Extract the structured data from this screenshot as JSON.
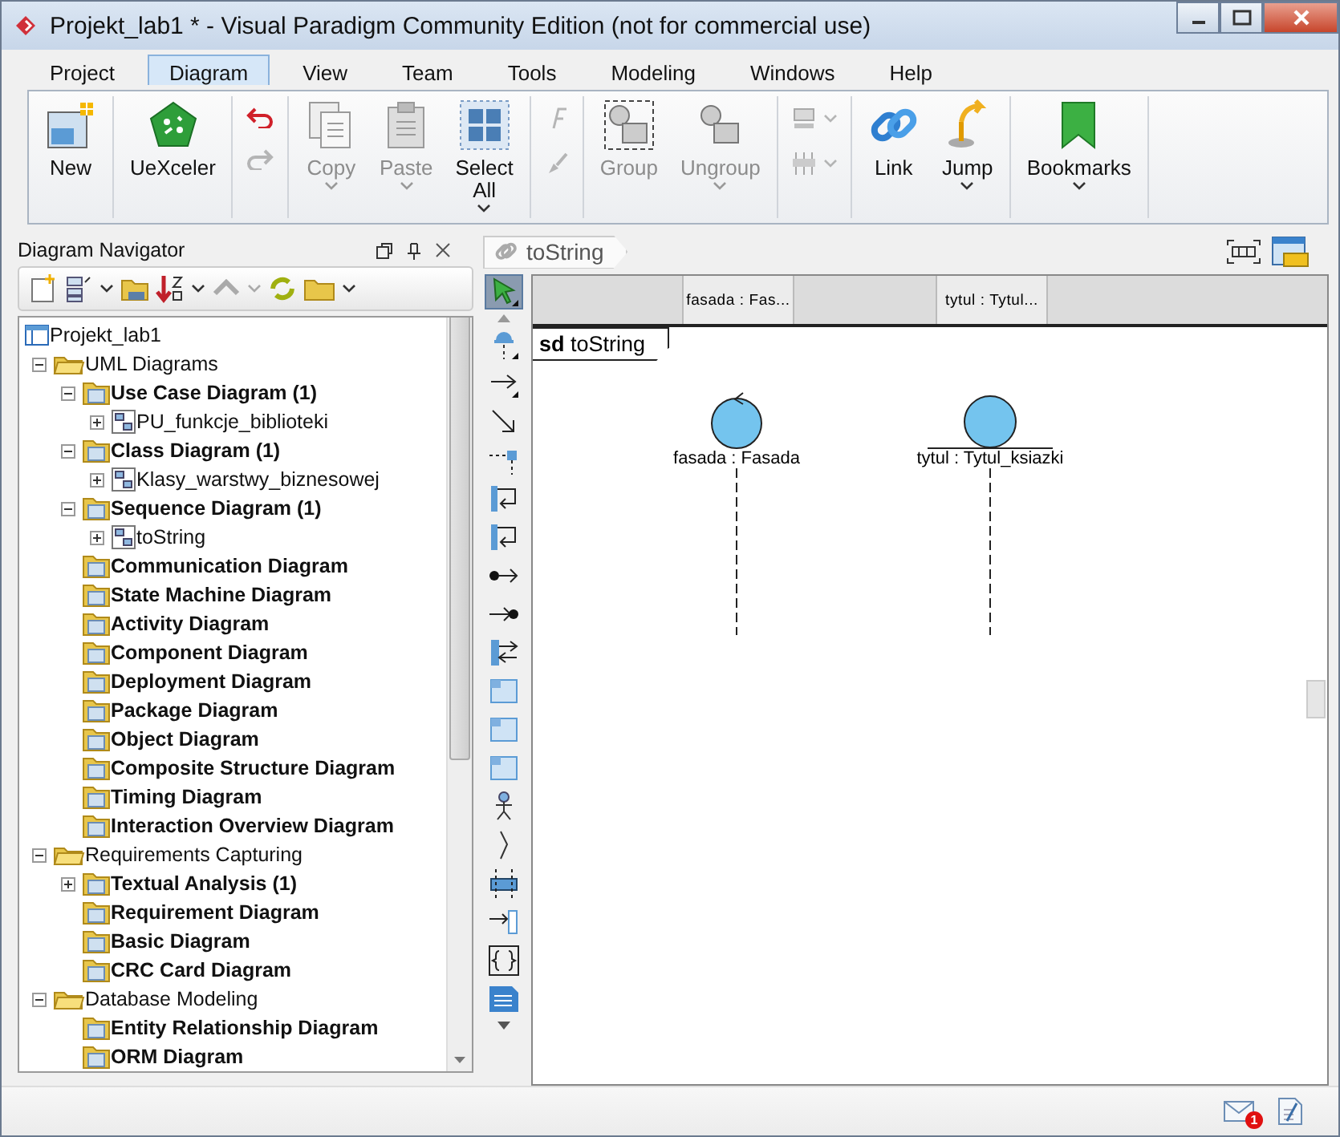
{
  "window": {
    "title": "Projekt_lab1 * - Visual Paradigm Community Edition (not for commercial use)"
  },
  "menu": [
    {
      "label": "Project",
      "selected": false
    },
    {
      "label": "Diagram",
      "selected": true
    },
    {
      "label": "View",
      "selected": false
    },
    {
      "label": "Team",
      "selected": false
    },
    {
      "label": "Tools",
      "selected": false
    },
    {
      "label": "Modeling",
      "selected": false
    },
    {
      "label": "Windows",
      "selected": false
    },
    {
      "label": "Help",
      "selected": false
    }
  ],
  "ribbon": {
    "groups": [
      {
        "kind": "large",
        "items": [
          {
            "kind": "new",
            "label": "New",
            "disabled": false,
            "dropdown": false
          }
        ]
      },
      {
        "kind": "large",
        "items": [
          {
            "kind": "pentagon",
            "label": "UeXceler",
            "disabled": false,
            "dropdown": false
          }
        ]
      },
      {
        "kind": "stack",
        "items": [
          {
            "kind": "undo",
            "disabled": false,
            "dropdown": false
          },
          {
            "kind": "redo",
            "disabled": true,
            "dropdown": false
          }
        ]
      },
      {
        "kind": "large",
        "items": [
          {
            "kind": "copy",
            "label": "Copy",
            "disabled": true,
            "dropdown": true
          },
          {
            "kind": "paste",
            "label": "Paste",
            "disabled": true,
            "dropdown": true
          },
          {
            "kind": "grid",
            "label": "Select All",
            "disabled": false,
            "dropdown": true
          }
        ]
      },
      {
        "kind": "stack",
        "items": [
          {
            "kind": "font",
            "disabled": true,
            "dropdown": false
          },
          {
            "kind": "brush",
            "disabled": true,
            "dropdown": false
          }
        ]
      },
      {
        "kind": "large",
        "items": [
          {
            "kind": "group",
            "label": "Group",
            "disabled": true,
            "dropdown": false
          },
          {
            "kind": "ungroup",
            "label": "Ungroup",
            "disabled": true,
            "dropdown": true
          }
        ]
      },
      {
        "kind": "stack",
        "items": [
          {
            "kind": "align",
            "disabled": true,
            "dropdown": true
          },
          {
            "kind": "distribute",
            "disabled": true,
            "dropdown": true
          }
        ]
      },
      {
        "kind": "large",
        "items": [
          {
            "kind": "link",
            "label": "Link",
            "disabled": false,
            "dropdown": false
          },
          {
            "kind": "jump",
            "label": "Jump",
            "disabled": false,
            "dropdown": true
          }
        ]
      },
      {
        "kind": "large",
        "items": [
          {
            "kind": "bookmark",
            "label": "Bookmarks",
            "disabled": false,
            "dropdown": true
          }
        ]
      }
    ]
  },
  "navigator": {
    "title": "Diagram Navigator",
    "tree": [
      {
        "kind": "project",
        "label": "Projekt_lab1",
        "children": [
          {
            "kind": "folder",
            "label": "UML Diagrams",
            "expanded": true,
            "children": [
              {
                "kind": "type",
                "label": "Use Case Diagram (1)",
                "expanded": true,
                "children": [
                  {
                    "kind": "diagram",
                    "label": "PU_funkcje_biblioteki",
                    "expanded": false
                  }
                ]
              },
              {
                "kind": "type",
                "label": "Class Diagram (1)",
                "expanded": true,
                "children": [
                  {
                    "kind": "diagram",
                    "label": "Klasy_warstwy_biznesowej",
                    "expanded": false
                  }
                ]
              },
              {
                "kind": "type",
                "label": "Sequence Diagram (1)",
                "expanded": true,
                "children": [
                  {
                    "kind": "diagram",
                    "label": "toString",
                    "expanded": false
                  }
                ]
              },
              {
                "kind": "type",
                "label": "Communication Diagram"
              },
              {
                "kind": "type",
                "label": "State Machine Diagram"
              },
              {
                "kind": "type",
                "label": "Activity Diagram"
              },
              {
                "kind": "type",
                "label": "Component Diagram"
              },
              {
                "kind": "type",
                "label": "Deployment Diagram"
              },
              {
                "kind": "type",
                "label": "Package Diagram"
              },
              {
                "kind": "type",
                "label": "Object Diagram"
              },
              {
                "kind": "type",
                "label": "Composite Structure Diagram"
              },
              {
                "kind": "type",
                "label": "Timing Diagram"
              },
              {
                "kind": "type",
                "label": "Interaction Overview Diagram"
              }
            ]
          },
          {
            "kind": "folder",
            "label": "Requirements Capturing",
            "expanded": true,
            "children": [
              {
                "kind": "type",
                "label": "Textual Analysis (1)",
                "expanded": false
              },
              {
                "kind": "type",
                "label": "Requirement Diagram"
              },
              {
                "kind": "type",
                "label": "Basic Diagram"
              },
              {
                "kind": "type",
                "label": "CRC Card Diagram"
              }
            ]
          },
          {
            "kind": "folder",
            "label": "Database Modeling",
            "expanded": true,
            "children": [
              {
                "kind": "type",
                "label": "Entity Relationship Diagram"
              },
              {
                "kind": "type",
                "label": "ORM Diagram"
              }
            ]
          }
        ]
      }
    ]
  },
  "editor": {
    "breadcrumb": "toString",
    "palette": [
      {
        "kind": "pointer",
        "selected": true
      },
      {
        "kind": "lifeline",
        "selected": false
      },
      {
        "kind": "arrow",
        "selected": false
      },
      {
        "kind": "diagonal",
        "selected": false
      },
      {
        "kind": "dashed",
        "selected": false
      },
      {
        "kind": "self",
        "selected": false
      },
      {
        "kind": "self",
        "selected": false
      },
      {
        "kind": "found",
        "selected": false
      },
      {
        "kind": "lost",
        "selected": false
      },
      {
        "kind": "swap",
        "selected": false
      },
      {
        "kind": "frame",
        "selected": false
      },
      {
        "kind": "frame",
        "selected": false
      },
      {
        "kind": "frame",
        "selected": false
      },
      {
        "kind": "actor",
        "selected": false
      },
      {
        "kind": "bracket",
        "selected": false
      },
      {
        "kind": "bar",
        "selected": false
      },
      {
        "kind": "gate",
        "selected": false
      },
      {
        "kind": "braces",
        "selected": false
      },
      {
        "kind": "note",
        "selected": false
      }
    ],
    "header_cells": [
      "fasada : Fas...",
      "tytul : Tytul..."
    ],
    "frame_label": "**sd** toString",
    "lifelines": [
      {
        "kind": "control",
        "label": "fasada : Fasada"
      },
      {
        "kind": "entity",
        "label": "tytul : Tytul_ksiazki"
      }
    ]
  },
  "status_bar": {
    "mail_badge": "1"
  }
}
